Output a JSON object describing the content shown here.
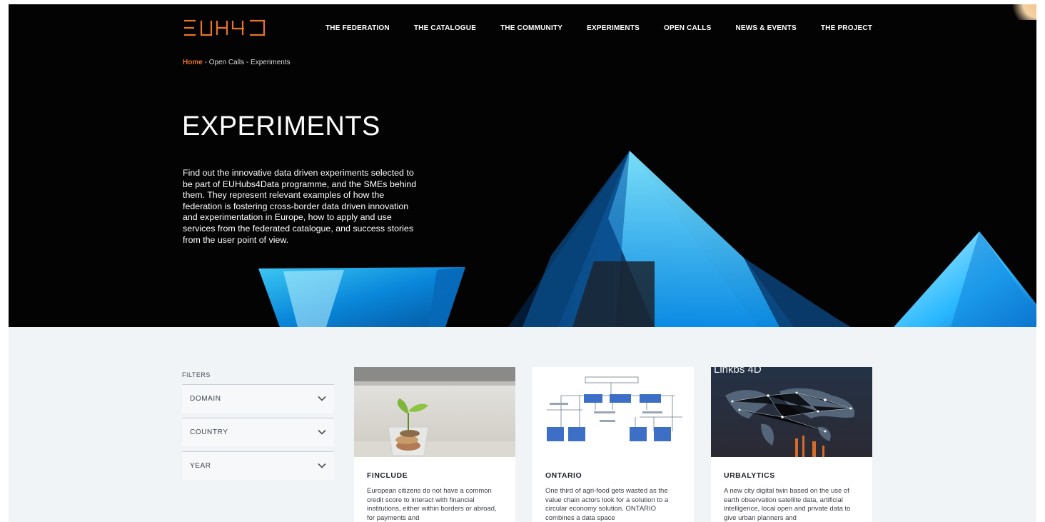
{
  "brand": {
    "logo_text": "EUH4D",
    "accent_color": "#e8742a"
  },
  "nav": {
    "items": [
      {
        "label": "THE FEDERATION"
      },
      {
        "label": "THE CATALOGUE"
      },
      {
        "label": "THE COMMUNITY"
      },
      {
        "label": "EXPERIMENTS"
      },
      {
        "label": "OPEN CALLS"
      },
      {
        "label": "NEWS & EVENTS"
      },
      {
        "label": "THE PROJECT"
      }
    ]
  },
  "breadcrumb": {
    "home": "Home",
    "separator": " - ",
    "parent": "Open Calls",
    "current": "Experiments"
  },
  "hero": {
    "title": "EXPERIMENTS",
    "description": "Find out the innovative data driven experiments selected to be part of EUHubs4Data programme, and the SMEs behind them. They represent relevant examples of how the federation is fostering cross-border data driven innovation and experimentation in Europe, how to apply and use services from the federated catalogue, and success stories from the user point of view."
  },
  "filters": {
    "label": "FILTERS",
    "items": [
      {
        "label": "DOMAIN",
        "icon": "chevron-down-icon"
      },
      {
        "label": "COUNTRY",
        "icon": "chevron-down-icon"
      },
      {
        "label": "YEAR",
        "icon": "chevron-down-icon"
      }
    ]
  },
  "cards": [
    {
      "title": "FINCLUDE",
      "text": "European citizens do not have a common credit score to interact with financial institutions, either within borders or abroad, for payments and",
      "image": "plant-in-coin-jar"
    },
    {
      "title": "ONTARIO",
      "text": "One third of agri-food gets wasted as the value chain actors look for a solution to a circular economy solution. ONTARIO combines a data space",
      "image": "flow-diagram"
    },
    {
      "title": "URBALYTICS",
      "text": "A new city digital twin based on the use of earth observation satellite data, artificial intelligence, local open and private data to give urban planners and",
      "image": "world-network-map",
      "image_caption": "Linkbs 4D"
    }
  ]
}
